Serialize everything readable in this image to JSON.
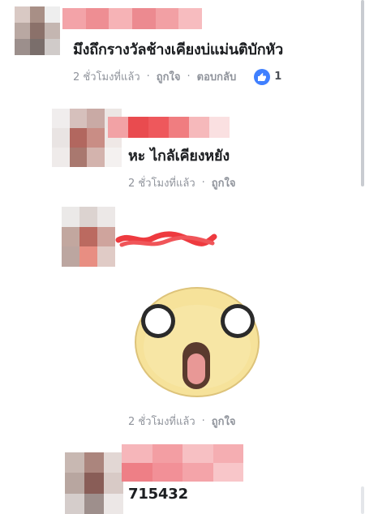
{
  "comments": [
    {
      "text": "มึงถึกรางวัลช้างเคียงบ่แม่นติบักหัว",
      "time": "2 ชั่วโมงที่แล้ว",
      "like_label": "ถูกใจ",
      "reply_label": "ตอบกลับ",
      "reaction_count": "1",
      "reaction_icon": "thumbs-up-icon"
    },
    {
      "text": "หะ ไกลัเคียงหยัง",
      "time": "2 ชั่วโมงที่แล้ว",
      "like_label": "ถูกใจ"
    },
    {
      "sticker": "shocked-face-sticker",
      "time": "2 ชั่วโมงที่แล้ว",
      "like_label": "ถูกใจ"
    },
    {
      "text": "715432"
    }
  ],
  "colors": {
    "meta_text": "#90949c",
    "like_badge": "#4080ff",
    "redaction_red": "#e8343a",
    "redaction_pink": "#f4a7a9"
  }
}
